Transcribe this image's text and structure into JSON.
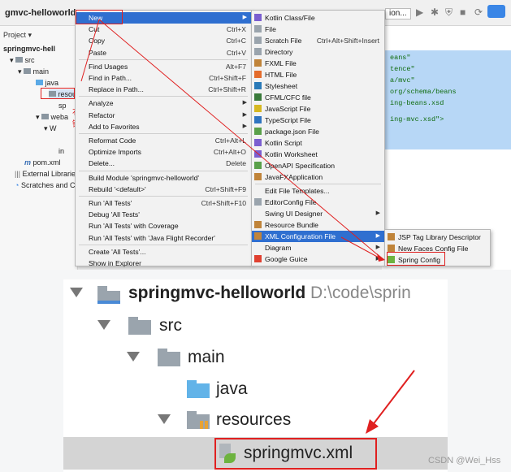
{
  "ide": {
    "title": "gmvc-helloworld",
    "right_title": "ion...",
    "project_label": "Project",
    "tree": [
      {
        "label": "springmvc-hell"
      },
      {
        "label": "src"
      },
      {
        "label": "main"
      },
      {
        "label": "java"
      },
      {
        "label": "resou"
      },
      {
        "label": "sp"
      },
      {
        "label": "weba"
      },
      {
        "label": "W"
      },
      {
        "label": "in"
      },
      {
        "label": "pom.xml"
      },
      {
        "label": "External Librarie"
      },
      {
        "label": "Scratches and Co"
      }
    ],
    "annotation": "右键",
    "code_lines": [
      "eans\"",
      "tence\"",
      "a/mvc\"",
      "org/schema/beans",
      "ing-beans.xsd",
      "",
      "ing-mvc.xsd\">"
    ]
  },
  "menu1": {
    "items": [
      {
        "label": "New",
        "shortcut": "",
        "has_sub": true
      },
      {
        "label": "Cut",
        "shortcut": "Ctrl+X",
        "icon": "scissors-icon"
      },
      {
        "label": "Copy",
        "shortcut": "Ctrl+C"
      },
      {
        "label": "Paste",
        "shortcut": "Ctrl+V",
        "icon": "clipboard-icon"
      },
      {
        "label": "Find Usages",
        "shortcut": "Alt+F7"
      },
      {
        "label": "Find in Path...",
        "shortcut": "Ctrl+Shift+F"
      },
      {
        "label": "Replace in Path...",
        "shortcut": "Ctrl+Shift+R"
      },
      {
        "label": "Analyze",
        "shortcut": "",
        "has_sub": true
      },
      {
        "label": "Refactor",
        "shortcut": "",
        "has_sub": true
      },
      {
        "label": "Add to Favorites",
        "shortcut": "",
        "has_sub": true
      },
      {
        "label": "Reformat Code",
        "shortcut": "Ctrl+Alt+L"
      },
      {
        "label": "Optimize Imports",
        "shortcut": "Ctrl+Alt+O"
      },
      {
        "label": "Delete...",
        "shortcut": "Delete"
      },
      {
        "label": "Build Module 'springmvc-helloworld'",
        "shortcut": ""
      },
      {
        "label": "Rebuild '<default>'",
        "shortcut": "Ctrl+Shift+F9"
      },
      {
        "label": "Run 'All Tests'",
        "shortcut": "Ctrl+Shift+F10"
      },
      {
        "label": "Debug 'All Tests'",
        "shortcut": ""
      },
      {
        "label": "Run 'All Tests' with Coverage",
        "shortcut": ""
      },
      {
        "label": "Run 'All Tests' with 'Java Flight Recorder'",
        "shortcut": ""
      },
      {
        "label": "Create 'All Tests'...",
        "shortcut": ""
      },
      {
        "label": "Show in Explorer",
        "shortcut": ""
      }
    ]
  },
  "menu2": {
    "items": [
      {
        "label": "Kotlin Class/File",
        "shortcut": ""
      },
      {
        "label": "File",
        "shortcut": ""
      },
      {
        "label": "Scratch File",
        "shortcut": "Ctrl+Alt+Shift+Insert"
      },
      {
        "label": "Directory",
        "shortcut": ""
      },
      {
        "label": "FXML File",
        "shortcut": ""
      },
      {
        "label": "HTML File",
        "shortcut": ""
      },
      {
        "label": "Stylesheet",
        "shortcut": ""
      },
      {
        "label": "CFML/CFC file",
        "shortcut": ""
      },
      {
        "label": "JavaScript File",
        "shortcut": ""
      },
      {
        "label": "TypeScript File",
        "shortcut": ""
      },
      {
        "label": "package.json File",
        "shortcut": ""
      },
      {
        "label": "Kotlin Script",
        "shortcut": ""
      },
      {
        "label": "Kotlin Worksheet",
        "shortcut": ""
      },
      {
        "label": "OpenAPI Specification",
        "shortcut": ""
      },
      {
        "label": "JavaFXApplication",
        "shortcut": ""
      },
      {
        "label": "Edit File Templates...",
        "shortcut": ""
      },
      {
        "label": "EditorConfig File",
        "shortcut": ""
      },
      {
        "label": "Swing UI Designer",
        "shortcut": "",
        "has_sub": true
      },
      {
        "label": "Resource Bundle",
        "shortcut": ""
      },
      {
        "label": "XML Configuration File",
        "shortcut": "",
        "has_sub": true
      },
      {
        "label": "Diagram",
        "shortcut": "",
        "has_sub": true
      },
      {
        "label": "Google Guice",
        "shortcut": "",
        "has_sub": true
      }
    ]
  },
  "menu3": {
    "items": [
      {
        "label": "JSP Tag Library Descriptor"
      },
      {
        "label": "New Faces Config File"
      },
      {
        "label": "Spring Config"
      }
    ]
  },
  "lower": {
    "project_name": "springmvc-helloworld",
    "project_path": "D:\\code\\sprin",
    "src": "src",
    "main": "main",
    "java": "java",
    "resources": "resources",
    "file": "springmvc.xml"
  },
  "watermark": "CSDN @Wei_Hss",
  "colors": {
    "highlight": "#2f6fd0",
    "annotation_red": "#e02020",
    "selection": "#b7d7f6"
  }
}
